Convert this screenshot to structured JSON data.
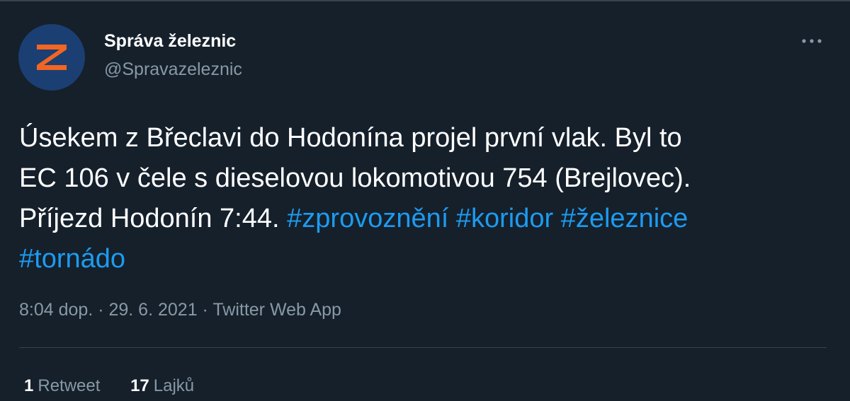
{
  "colors": {
    "background": "#15202b",
    "avatar_bg": "#1b3f72",
    "avatar_logo": "#f26522",
    "link": "#1d9bf0",
    "muted": "#8899a6"
  },
  "author": {
    "name": "Správa železnic",
    "handle": "@Spravazeleznic",
    "avatar_icon": "sz-logo-icon"
  },
  "more_icon": "more-dots-icon",
  "tweet": {
    "line1": "Úsekem z Břeclavi do Hodonína projel první vlak. Byl to",
    "line2": "EC 106 v čele s dieselovou lokomotivou 754 (Brejlovec).",
    "line3_text": "Příjezd Hodonín 7:44. ",
    "hashtags": [
      "#zprovoznění",
      "#koridor",
      "#železnice",
      "#tornádo"
    ]
  },
  "meta": {
    "time": "8:04 dop.",
    "sep1": " · ",
    "date": "29. 6. 2021",
    "sep2": " · ",
    "source": "Twitter Web App"
  },
  "stats": {
    "retweets_count": "1",
    "retweets_label": "Retweet",
    "likes_count": "17",
    "likes_label": "Lajků"
  }
}
